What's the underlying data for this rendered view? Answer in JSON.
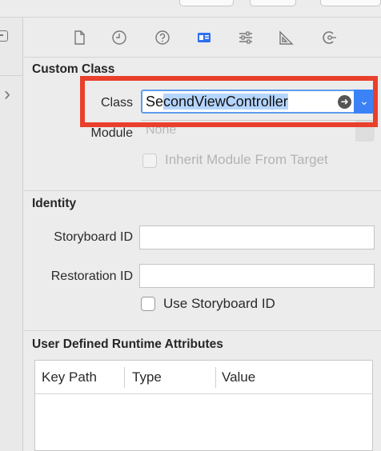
{
  "toolbar": {
    "icons": [
      "file-icon",
      "clock-icon",
      "help-icon",
      "identity-icon",
      "attributes-icon",
      "ruler-icon",
      "connections-icon"
    ],
    "accent_color": "#2f6ff0"
  },
  "custom_class": {
    "title": "Custom Class",
    "class_label": "Class",
    "class_value_prefix": "Se",
    "class_value_selected": "condViewController",
    "module_label": "Module",
    "module_placeholder": "None",
    "inherit_label": "Inherit Module From Target"
  },
  "identity": {
    "title": "Identity",
    "storyboard_id_label": "Storyboard ID",
    "storyboard_id_value": "",
    "restoration_id_label": "Restoration ID",
    "restoration_id_value": "",
    "use_storyboard_label": "Use Storyboard ID"
  },
  "runtime_attributes": {
    "title": "User Defined Runtime Attributes",
    "columns": [
      "Key Path",
      "Type",
      "Value"
    ]
  },
  "colors": {
    "highlight": "#e8402c",
    "selection": "#b5d5ff",
    "dropdown": "#3b82f6"
  }
}
